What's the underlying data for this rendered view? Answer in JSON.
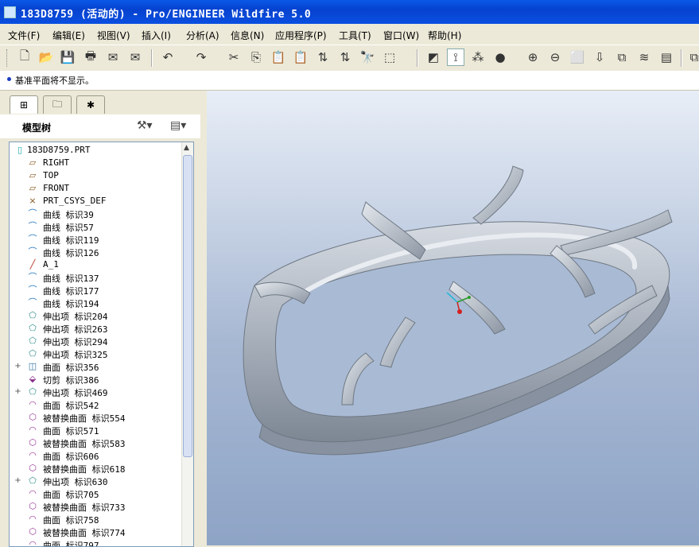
{
  "window": {
    "title": "183D8759 (活动的) - Pro/ENGINEER Wildfire 5.0"
  },
  "menu": [
    {
      "label": "文件(F)"
    },
    {
      "label": "编辑(E)"
    },
    {
      "label": "视图(V)"
    },
    {
      "label": "插入(I)"
    },
    {
      "label": "分析(A)"
    },
    {
      "label": "信息(N)"
    },
    {
      "label": "应用程序(P)"
    },
    {
      "label": "工具(T)"
    },
    {
      "label": "窗口(W)"
    },
    {
      "label": "帮助(H)"
    }
  ],
  "toolbar": {
    "buttons": [
      {
        "name": "new-file-icon",
        "glyph": "🗋"
      },
      {
        "name": "open-file-icon",
        "glyph": "📂"
      },
      {
        "name": "save-icon",
        "glyph": "💾"
      },
      {
        "name": "print-icon",
        "glyph": "🖶"
      },
      {
        "name": "mail-icon",
        "glyph": "✉"
      },
      {
        "name": "mail-attach-icon",
        "glyph": "✉"
      },
      {
        "name": "undo-icon",
        "glyph": "↶"
      },
      {
        "name": "redo-icon",
        "glyph": "↷"
      },
      {
        "name": "cut-icon",
        "glyph": "✂"
      },
      {
        "name": "copy-icon",
        "glyph": "⎘"
      },
      {
        "name": "paste-icon",
        "glyph": "📋"
      },
      {
        "name": "paste-special-icon",
        "glyph": "📋"
      },
      {
        "name": "regenerate-icon",
        "glyph": "⇅"
      },
      {
        "name": "regenerate-manager-icon",
        "glyph": "⇅"
      },
      {
        "name": "find-icon",
        "glyph": "🔭"
      },
      {
        "name": "select-box-icon",
        "glyph": "⬚"
      },
      {
        "name": "datum-display-icon",
        "glyph": "◩"
      },
      {
        "name": "axis-display-icon",
        "glyph": "⟟"
      },
      {
        "name": "point-display-icon",
        "glyph": "⁂"
      },
      {
        "name": "shading-icon",
        "glyph": "●"
      },
      {
        "name": "zoom-in-icon",
        "glyph": "⊕"
      },
      {
        "name": "zoom-out-icon",
        "glyph": "⊖"
      },
      {
        "name": "refit-icon",
        "glyph": "⬜"
      },
      {
        "name": "reorient-icon",
        "glyph": "⇩"
      },
      {
        "name": "saved-views-icon",
        "glyph": "⧉"
      },
      {
        "name": "layers-icon",
        "glyph": "≋"
      },
      {
        "name": "view-manager-icon",
        "glyph": "▤"
      },
      {
        "name": "model-tree-toggle-icon",
        "glyph": "⧉"
      }
    ]
  },
  "message": {
    "text": "基准平面将不显示。"
  },
  "left_panel": {
    "tabs": [
      {
        "name": "tab-model-tree",
        "glyph": "⊞",
        "active": true
      },
      {
        "name": "tab-folder-browser",
        "glyph": "🗀",
        "active": false
      },
      {
        "name": "tab-favorites",
        "glyph": "✱",
        "active": false
      }
    ],
    "title": "模型树",
    "settings_glyph": "⚒▾",
    "show_glyph": "▤▾",
    "tree": [
      {
        "label": "183D8759.PRT",
        "icon": "part",
        "expander": "",
        "root": true
      },
      {
        "label": "RIGHT",
        "icon": "plane",
        "expander": ""
      },
      {
        "label": "TOP",
        "icon": "plane",
        "expander": ""
      },
      {
        "label": "FRONT",
        "icon": "plane",
        "expander": ""
      },
      {
        "label": "PRT_CSYS_DEF",
        "icon": "csys",
        "expander": ""
      },
      {
        "label": "曲线 标识39",
        "icon": "curve",
        "expander": ""
      },
      {
        "label": "曲线 标识57",
        "icon": "curve",
        "expander": ""
      },
      {
        "label": "曲线 标识119",
        "icon": "curve",
        "expander": ""
      },
      {
        "label": "曲线 标识126",
        "icon": "curve",
        "expander": ""
      },
      {
        "label": "A_1",
        "icon": "axis",
        "expander": ""
      },
      {
        "label": "曲线 标识137",
        "icon": "curve",
        "expander": ""
      },
      {
        "label": "曲线 标识177",
        "icon": "curve",
        "expander": ""
      },
      {
        "label": "曲线 标识194",
        "icon": "curve",
        "expander": ""
      },
      {
        "label": "伸出项 标识204",
        "icon": "protrusion",
        "expander": ""
      },
      {
        "label": "伸出项 标识263",
        "icon": "protrusion",
        "expander": ""
      },
      {
        "label": "伸出项 标识294",
        "icon": "protrusion",
        "expander": ""
      },
      {
        "label": "伸出项 标识325",
        "icon": "protrusion",
        "expander": ""
      },
      {
        "label": "曲面 标识356",
        "icon": "surface",
        "expander": "+"
      },
      {
        "label": "切剪 标识386",
        "icon": "cut",
        "expander": ""
      },
      {
        "label": "伸出项 标识469",
        "icon": "protrusion",
        "expander": "+"
      },
      {
        "label": "曲面 标识542",
        "icon": "surface-purple",
        "expander": ""
      },
      {
        "label": "被替换曲面 标识554",
        "icon": "replaced",
        "expander": ""
      },
      {
        "label": "曲面 标识571",
        "icon": "surface-purple",
        "expander": ""
      },
      {
        "label": "被替换曲面 标识583",
        "icon": "replaced",
        "expander": ""
      },
      {
        "label": "曲面 标识606",
        "icon": "surface-purple",
        "expander": ""
      },
      {
        "label": "被替换曲面 标识618",
        "icon": "replaced",
        "expander": ""
      },
      {
        "label": "伸出项 标识630",
        "icon": "protrusion",
        "expander": "+"
      },
      {
        "label": "曲面 标识705",
        "icon": "surface-purple",
        "expander": ""
      },
      {
        "label": "被替换曲面 标识733",
        "icon": "replaced",
        "expander": ""
      },
      {
        "label": "曲面 标识758",
        "icon": "surface-purple",
        "expander": ""
      },
      {
        "label": "被替换曲面 标识774",
        "icon": "replaced",
        "expander": ""
      },
      {
        "label": "曲面 标识797",
        "icon": "surface-purple",
        "expander": ""
      }
    ]
  },
  "colors": {
    "title_bar": "#0a4fe0",
    "viewport_top": "#e8eef7",
    "viewport_bottom": "#8ea4c6",
    "model_gray": "#aab2bd"
  }
}
